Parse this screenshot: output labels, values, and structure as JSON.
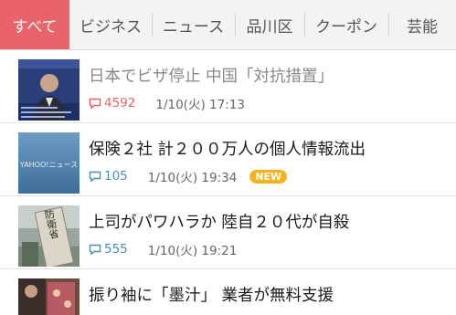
{
  "tabs": [
    {
      "label": "すべて",
      "active": true
    },
    {
      "label": "ビジネス",
      "active": false
    },
    {
      "label": "ニュース",
      "active": false
    },
    {
      "label": "品川区",
      "active": false
    },
    {
      "label": "クーポン",
      "active": false
    },
    {
      "label": "芸能",
      "active": false
    }
  ],
  "articles": [
    {
      "title": "日本でビザ停止 中国「対抗措置」",
      "comments": "4592",
      "date": "1/10(火) 17:13",
      "read": true,
      "hot": true,
      "new_badge": "",
      "thumb_icon": "news-photo-icon"
    },
    {
      "title": "保険２社 計２００万人の個人情報流出",
      "comments": "105",
      "date": "1/10(火) 19:34",
      "read": false,
      "hot": false,
      "new_badge": "NEW",
      "thumb_icon": "yahoo-news-placeholder-icon"
    },
    {
      "title": "上司がパワハラか 陸自２０代が自殺",
      "comments": "555",
      "date": "1/10(火) 19:21",
      "read": false,
      "hot": false,
      "new_badge": "",
      "thumb_icon": "sign-photo-icon"
    },
    {
      "title": "振り袖に「墨汁」 業者が無料支援",
      "comments": "",
      "date": "",
      "read": false,
      "hot": false,
      "new_badge": "",
      "thumb_icon": "kimono-photo-icon"
    }
  ],
  "thumb_yahoo_text": "YAHOO!ニュース",
  "thumb_sign_text": "防衛省",
  "colors": {
    "accent": "#e8636a",
    "comment_blue": "#4a8db8",
    "new_badge": "#f5b21e"
  }
}
